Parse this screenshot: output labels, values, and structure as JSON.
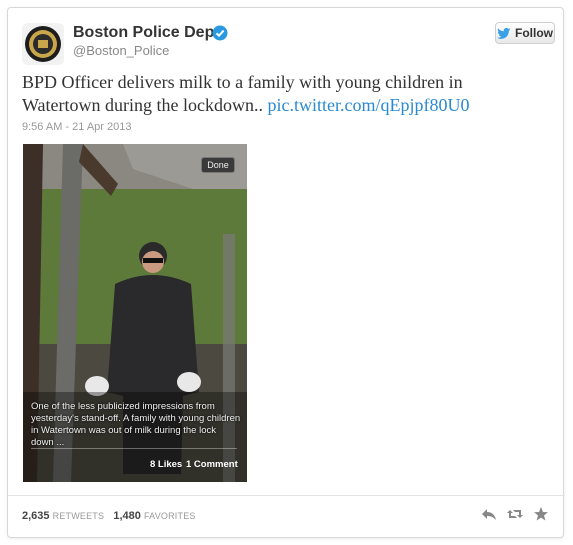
{
  "header": {
    "name": "Boston Police Dept.",
    "handle": "@Boston_Police",
    "verified_icon": "verified-badge-icon",
    "follow_label": "Follow"
  },
  "tweet": {
    "text": "BPD Officer delivers milk to a family with young children in Watertown during the lockdown.. ",
    "link": "pic.twitter.com/qEpjpf80U0",
    "timestamp": "9:56 AM - 21 Apr 2013"
  },
  "photo": {
    "done_label": "Done",
    "caption": "One of the less publicized impressions from yesterday's stand-off. A family with young children in Watertown was out of milk during the lock down ...",
    "likes": "8 Likes",
    "comments": "1 Comment"
  },
  "stats": {
    "retweets_count": "2,635",
    "retweets_label": "RETWEETS",
    "favorites_count": "1,480",
    "favorites_label": "FAVORITES"
  },
  "colors": {
    "link": "#2a8ad0",
    "verified": "#2a9ae0"
  }
}
